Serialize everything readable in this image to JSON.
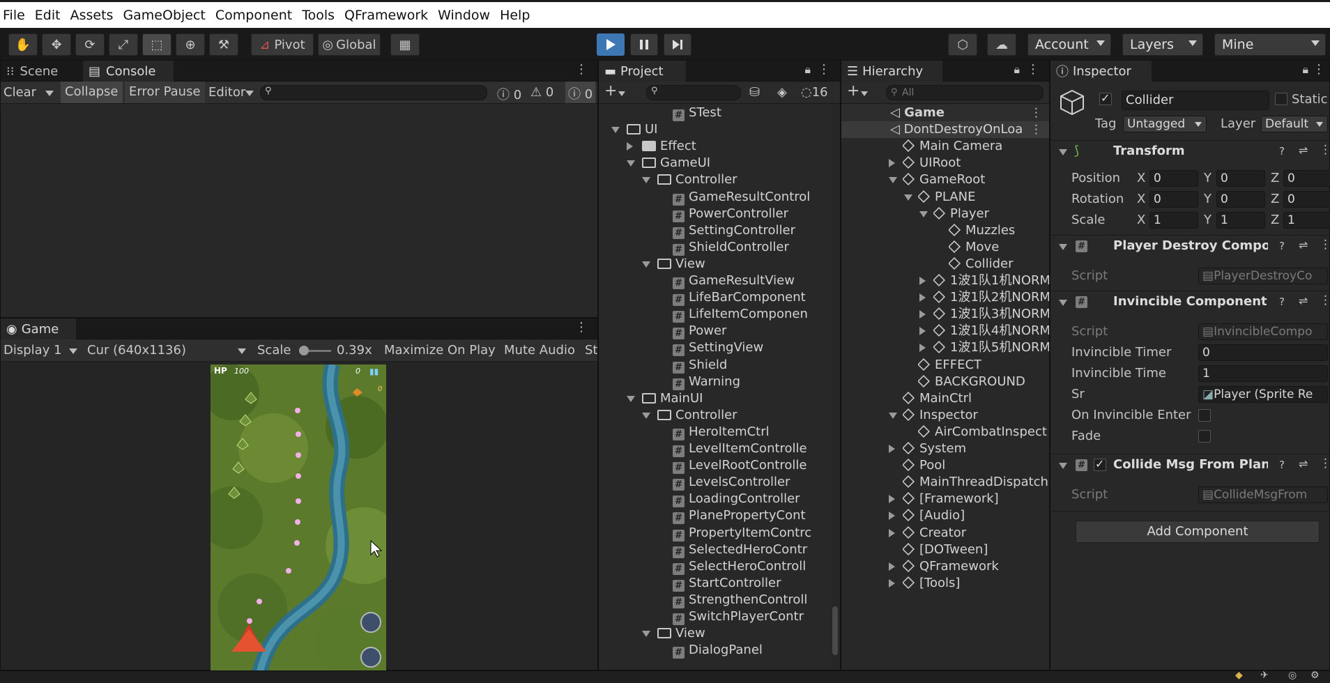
{
  "menu": [
    "File",
    "Edit",
    "Assets",
    "GameObject",
    "Component",
    "Tools",
    "QFramework",
    "Window",
    "Help"
  ],
  "toolbar": {
    "pivot": "Pivot",
    "global": "Global",
    "account": "Account",
    "layers": "Layers",
    "layout": "Mine"
  },
  "scene_panel": {
    "tabs": [
      "Scene",
      "Console"
    ],
    "clear": "Clear",
    "collapse": "Collapse",
    "error_pause": "Error Pause",
    "editor": "Editor",
    "log_count": "0",
    "warn_count": "0",
    "err_count": "0"
  },
  "game_panel": {
    "tab": "Game",
    "display": "Display 1",
    "resolution": "Cur (640x1136)",
    "scale_label": "Scale",
    "scale_value": "0.39x",
    "maximize": "Maximize On Play",
    "mute": "Mute Audio",
    "stats": "St",
    "hud_hp": "HP",
    "hud_hp_value": "100",
    "hud_score": "0",
    "hud_coins": "0"
  },
  "project": {
    "tab": "Project",
    "hidden_count": "16",
    "rows": [
      {
        "text": "STest",
        "icon": "script"
      },
      {
        "text": "UI",
        "icon": "folder-open"
      },
      {
        "text": "Effect",
        "icon": "folder"
      },
      {
        "text": "GameUI",
        "icon": "folder-open"
      },
      {
        "text": "Controller",
        "icon": "folder-open"
      },
      {
        "text": "GameResultControl",
        "icon": "script"
      },
      {
        "text": "PowerController",
        "icon": "script"
      },
      {
        "text": "SettingController",
        "icon": "script"
      },
      {
        "text": "ShieldController",
        "icon": "script"
      },
      {
        "text": "View",
        "icon": "folder-open"
      },
      {
        "text": "GameResultView",
        "icon": "script"
      },
      {
        "text": "LifeBarComponent",
        "icon": "script"
      },
      {
        "text": "LifeItemComponen",
        "icon": "script"
      },
      {
        "text": "Power",
        "icon": "script"
      },
      {
        "text": "SettingView",
        "icon": "script"
      },
      {
        "text": "Shield",
        "icon": "script"
      },
      {
        "text": "Warning",
        "icon": "script"
      },
      {
        "text": "MainUI",
        "icon": "folder-open"
      },
      {
        "text": "Controller",
        "icon": "folder-open"
      },
      {
        "text": "HeroItemCtrl",
        "icon": "script"
      },
      {
        "text": "LevelItemControlle",
        "icon": "script"
      },
      {
        "text": "LevelRootControlle",
        "icon": "script"
      },
      {
        "text": "LevelsController",
        "icon": "script"
      },
      {
        "text": "LoadingController",
        "icon": "script"
      },
      {
        "text": "PlanePropertyCont",
        "icon": "script"
      },
      {
        "text": "PropertyItemContrc",
        "icon": "script"
      },
      {
        "text": "SelectedHeroContr",
        "icon": "script"
      },
      {
        "text": "SelectHeroControll",
        "icon": "script"
      },
      {
        "text": "StartController",
        "icon": "script"
      },
      {
        "text": "StrengthenControll",
        "icon": "script"
      },
      {
        "text": "SwitchPlayerContr",
        "icon": "script"
      },
      {
        "text": "View",
        "icon": "folder-open"
      },
      {
        "text": "DialogPanel",
        "icon": "script"
      }
    ]
  },
  "hierarchy": {
    "tab": "Hierarchy",
    "search_placeholder": "All",
    "rows": [
      {
        "text": "Game",
        "icon": "scene"
      },
      {
        "text": "DontDestroyOnLoa",
        "icon": "scene"
      },
      {
        "text": "Main Camera",
        "icon": "cube"
      },
      {
        "text": "UIRoot",
        "icon": "cube"
      },
      {
        "text": "GameRoot",
        "icon": "cube"
      },
      {
        "text": "PLANE",
        "icon": "cube"
      },
      {
        "text": "Player",
        "icon": "cube"
      },
      {
        "text": "Muzzles",
        "icon": "cube"
      },
      {
        "text": "Move",
        "icon": "cube"
      },
      {
        "text": "Collider",
        "icon": "cube"
      },
      {
        "text": "1波1队1机NORM",
        "icon": "cube"
      },
      {
        "text": "1波1队2机NORM",
        "icon": "cube"
      },
      {
        "text": "1波1队3机NORM",
        "icon": "cube"
      },
      {
        "text": "1波1队4机NORM",
        "icon": "cube"
      },
      {
        "text": "1波1队5机NORM",
        "icon": "cube"
      },
      {
        "text": "EFFECT",
        "icon": "cube"
      },
      {
        "text": "BACKGROUND",
        "icon": "cube"
      },
      {
        "text": "MainCtrl",
        "icon": "cube"
      },
      {
        "text": "Inspector",
        "icon": "cube"
      },
      {
        "text": "AirCombatInspect",
        "icon": "cube"
      },
      {
        "text": "System",
        "icon": "cube"
      },
      {
        "text": "Pool",
        "icon": "cube"
      },
      {
        "text": "MainThreadDispatch",
        "icon": "cube"
      },
      {
        "text": "[Framework]",
        "icon": "cube"
      },
      {
        "text": "[Audio]",
        "icon": "cube"
      },
      {
        "text": "Creator",
        "icon": "cube"
      },
      {
        "text": "[DOTween]",
        "icon": "cube"
      },
      {
        "text": "QFramework",
        "icon": "cube"
      },
      {
        "text": "[Tools]",
        "icon": "cube"
      }
    ]
  },
  "inspector": {
    "tab": "Inspector",
    "object_name": "Collider",
    "static_label": "Static",
    "tag_label": "Tag",
    "tag_value": "Untagged",
    "layer_label": "Layer",
    "layer_value": "Default",
    "transform": {
      "title": "Transform",
      "position_label": "Position",
      "rotation_label": "Rotation",
      "scale_label": "Scale",
      "x": "X",
      "y": "Y",
      "z": "Z",
      "position": [
        "0",
        "0",
        "0"
      ],
      "rotation": [
        "0",
        "0",
        "0"
      ],
      "scale": [
        "1",
        "1",
        "1"
      ]
    },
    "player_destroy": {
      "title": "Player Destroy Compone",
      "script_label": "Script",
      "script_value": "PlayerDestroyCo"
    },
    "invincible": {
      "title": "Invincible Component (S",
      "script_label": "Script",
      "script_value": "InvincibleCompo",
      "timer_label": "Invincible Timer",
      "timer_value": "0",
      "time_label": "Invincible Time",
      "time_value": "1",
      "sr_label": "Sr",
      "sr_value": "Player (Sprite Re",
      "on_enter_label": "On Invincible Enter",
      "fade_label": "Fade"
    },
    "collide_msg": {
      "title": "Collide Msg From Plane",
      "script_label": "Script",
      "script_value": "CollideMsgFrom"
    },
    "add_component": "Add Component"
  }
}
